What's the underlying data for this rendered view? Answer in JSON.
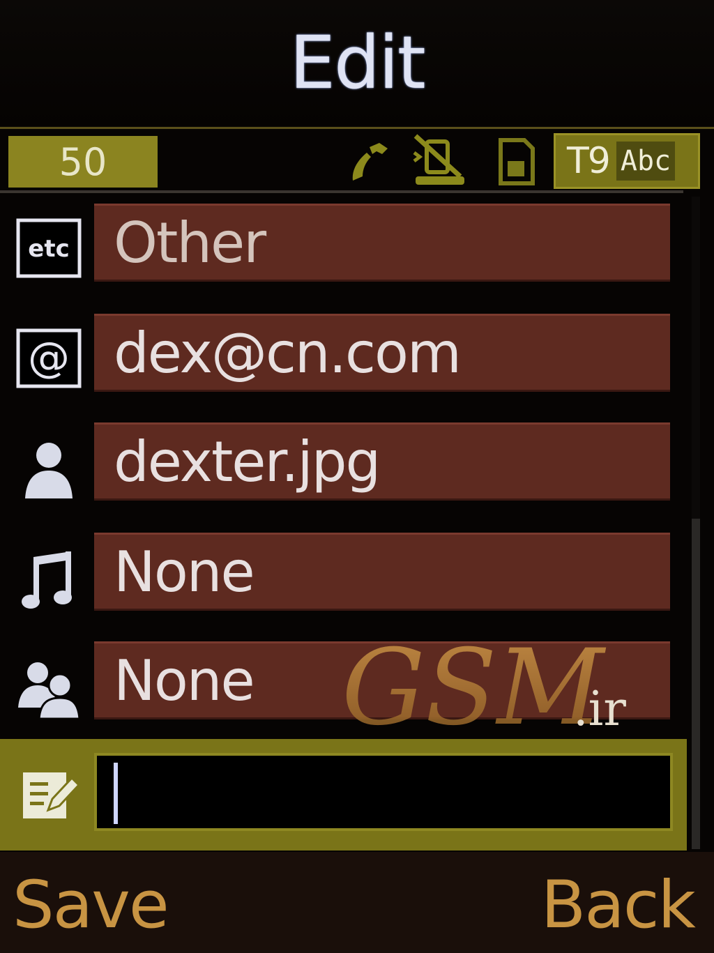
{
  "header": {
    "title": "Edit"
  },
  "status": {
    "char_counter": "50",
    "input_mode_prefix": "T9",
    "input_mode_case": "Abc",
    "icons": [
      "phone-icon",
      "vibrate-icon",
      "sim-card-icon"
    ]
  },
  "fields": [
    {
      "icon": "etc-icon",
      "value": "Other"
    },
    {
      "icon": "email-icon",
      "value": "dex@cn.com"
    },
    {
      "icon": "person-icon",
      "value": "dexter.jpg"
    },
    {
      "icon": "music-note-icon",
      "value": "None"
    },
    {
      "icon": "group-icon",
      "value": "None"
    }
  ],
  "active_field": {
    "icon": "note-edit-icon",
    "value": ""
  },
  "watermark": {
    "text": "GSM",
    "suffix": ".ir"
  },
  "softkeys": {
    "left": "Save",
    "right": "Back"
  },
  "colors": {
    "field_bg": "#5e2a20",
    "accent_olive": "#7a7418",
    "softkey_text": "#c89443",
    "title_text": "#dfe3f4"
  }
}
